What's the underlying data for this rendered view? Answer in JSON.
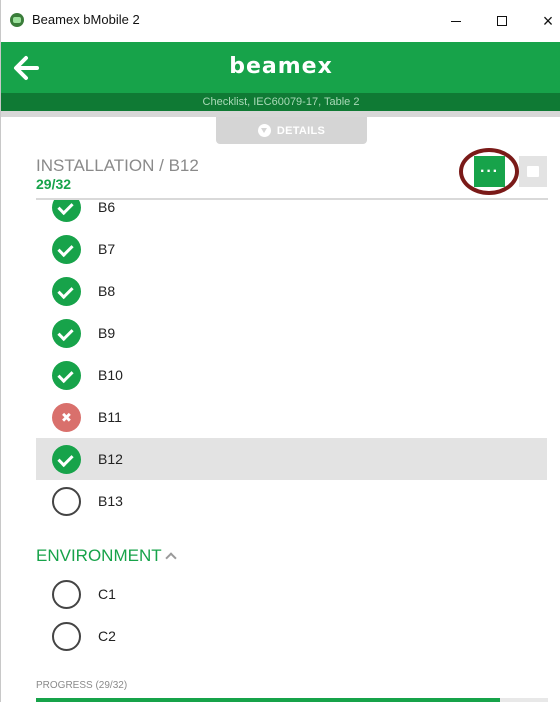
{
  "window": {
    "title": "Beamex bMobile 2",
    "minimize": "minimize",
    "maximize": "maximize",
    "close": "×"
  },
  "header": {
    "brand": "beamex",
    "subtitle": "Checklist, IEC60079-17, Table 2",
    "details_label": "DETAILS"
  },
  "section": {
    "title": "INSTALLATION / B12",
    "count": "29/32",
    "more_label": "···"
  },
  "items": [
    {
      "label": "B6",
      "status": "pass",
      "selected": false
    },
    {
      "label": "B7",
      "status": "pass",
      "selected": false
    },
    {
      "label": "B8",
      "status": "pass",
      "selected": false
    },
    {
      "label": "B9",
      "status": "pass",
      "selected": false
    },
    {
      "label": "B10",
      "status": "pass",
      "selected": false
    },
    {
      "label": "B11",
      "status": "fail",
      "selected": false
    },
    {
      "label": "B12",
      "status": "pass",
      "selected": true
    },
    {
      "label": "B13",
      "status": "none",
      "selected": false
    }
  ],
  "environment": {
    "title": "ENVIRONMENT",
    "items": [
      {
        "label": "C1",
        "status": "none"
      },
      {
        "label": "C2",
        "status": "none"
      }
    ]
  },
  "progress": {
    "label": "PROGRESS (29/32)",
    "value": 0.906
  },
  "colors": {
    "brand_green": "#17a34a",
    "dark_green": "#0f7a34",
    "fail_red": "#d9706c",
    "highlight_ring": "#7a1a18"
  },
  "icons": {
    "back": "arrow-left-icon",
    "details": "circle-down-icon",
    "pass": "check-circle-icon",
    "fail": "x-circle-icon",
    "none": "empty-circle-icon",
    "collapse": "chevron-up-icon"
  }
}
